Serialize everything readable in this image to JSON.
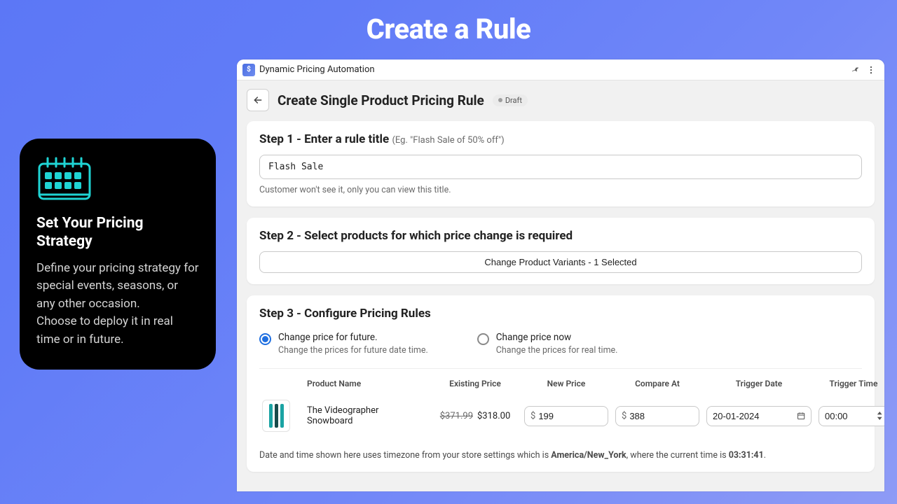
{
  "page_banner": "Create a Rule",
  "side": {
    "title": "Set Your Pricing Strategy",
    "body": "Define your pricing strategy for special events, seasons, or any other occasion.\nChoose to deploy it in real time or in future."
  },
  "app": {
    "name": "Dynamic Pricing Automation",
    "page_title": "Create Single Product Pricing Rule",
    "status_badge": "Draft"
  },
  "step1": {
    "title": "Step 1 - Enter a rule title",
    "hint": "(Eg. \"Flash Sale of 50% off\")",
    "value": "Flash Sale",
    "helper": "Customer won't see it, only you can view this title."
  },
  "step2": {
    "title": "Step 2 - Select products for which price change is required",
    "button_label": "Change Product Variants - 1 Selected"
  },
  "step3": {
    "title": "Step 3 - Configure Pricing Rules",
    "options": [
      {
        "label": "Change price for future.",
        "sub": "Change the prices for future date time.",
        "selected": true
      },
      {
        "label": "Change price now",
        "sub": "Change the prices for real time.",
        "selected": false
      }
    ],
    "columns": [
      "",
      "Product Name",
      "Existing Price",
      "New Price",
      "Compare At",
      "Trigger Date",
      "Trigger Time"
    ],
    "row": {
      "product_name": "The Videographer Snowboard",
      "existing_old": "$371.99",
      "existing_new": "$318.00",
      "new_price": "199",
      "compare_at": "388",
      "trigger_date": "20-01-2024",
      "trigger_time": "00:00",
      "currency": "$"
    },
    "tz_prefix": "Date and time shown here uses timezone from your store settings which is ",
    "tz_name": "America/New_York",
    "tz_mid": ", where the current time is ",
    "tz_time": "03:31:41",
    "tz_suffix": "."
  }
}
